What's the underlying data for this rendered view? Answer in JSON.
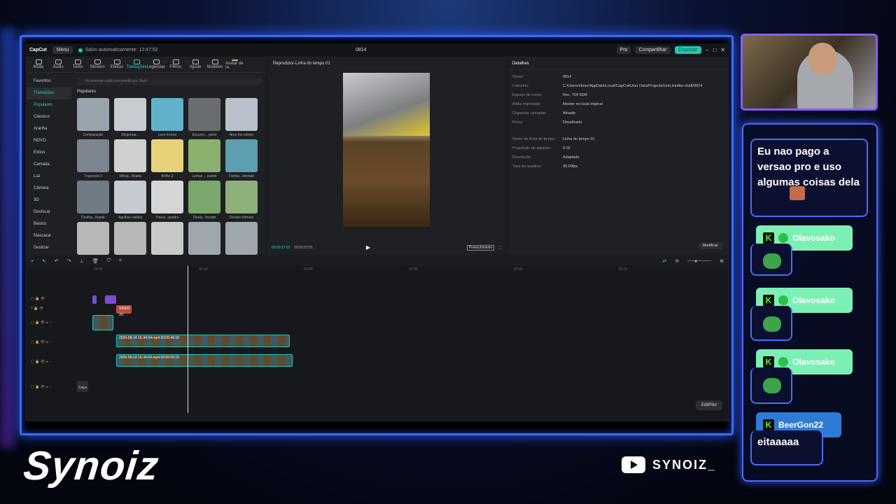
{
  "app": {
    "logo": "CapCut",
    "menu": "Menu",
    "autosave": "Salvo automaticamente: 12:47:52",
    "project_title": "0814",
    "pro": "Pro",
    "share": "Compartilhar",
    "export": "Exportar"
  },
  "tabs": [
    "Mídia",
    "Áudio",
    "Texto",
    "Stickers",
    "Efeitos",
    "Transições",
    "Legendas",
    "Filtros",
    "Ajuste",
    "Modelos",
    "Avatar de IA"
  ],
  "categories": [
    "Favoritos",
    "Transições",
    "Populares",
    "Clássico",
    "Aranha",
    "NOVO",
    "Exitos",
    "Camada",
    "Luz",
    "Câmera",
    "3D",
    "Desfocar",
    "Básico",
    "Mascarar",
    "Deslizar"
  ],
  "search_placeholder": "As pessoas estão procurando por: flash",
  "popular_label": "Populares",
  "transitions": [
    "Comparação",
    "Dispersar...",
    "Leve tremor",
    "Escurec... preto",
    "Arco-íris etéreo",
    "Travessia 3",
    "Vibraç...ficada",
    "Brilho 2",
    "Linhas ... painel",
    "Fantas...trêmulo",
    "Desfoq...lhante",
    "Agulhas radiais",
    "Transi...quadro",
    "Desliz...focado",
    "Deslize trêmulo",
    "",
    "",
    "",
    "",
    ""
  ],
  "player": {
    "title": "Reprodutor-Linha do tempo 01",
    "current": "00:00:27:03",
    "total": "00:00:57:01",
    "fill": "Preenchimento"
  },
  "details": {
    "title": "Detalhes",
    "rows": [
      {
        "k": "Nome:",
        "v": "0814"
      },
      {
        "k": "Caminho:",
        "v": "C:/Users/sbner/AppData/Local/CapCut/User Data/Projects/com.lveditor.draft/0814"
      },
      {
        "k": "Espaço de cores:",
        "v": "Rec. 709 SDR"
      },
      {
        "k": "Mídia importada:",
        "v": "Manter no local original"
      },
      {
        "k": "Organizar camadas",
        "v": "Ativado"
      },
      {
        "k": "Proxy:",
        "v": "Desativado"
      },
      {
        "k": "Nome da linha do tempo:",
        "v": "Linha do tempo 01"
      },
      {
        "k": "Proporção de aspecto:",
        "v": "9:16"
      },
      {
        "k": "Resolução:",
        "v": "Adaptado"
      },
      {
        "k": "Taxa de quadros:",
        "v": "30.00fps"
      }
    ],
    "modify": "Modificar"
  },
  "timeline": {
    "ruler": [
      "00:00",
      "00:30",
      "01:00",
      "01:30",
      "02:00",
      "02:30"
    ],
    "clip1": "2026-08-14 15-34-54.mp4  00:00:49:18",
    "clip2": "2026-08-14 15-34-54.mp4  00:00:50:15",
    "text_clip": "VIDEO JO",
    "cover": "Capa",
    "editpilot": "EditPilot"
  },
  "chat": {
    "message1": "Eu nao pago a versao pro e uso algumas coisas dela",
    "user1": "Olavosako",
    "user2": "Olavosako",
    "user3": "Olavosako",
    "user4": "BeerGon22",
    "message4": "eitaaaaa"
  },
  "brand": {
    "name": "Synoiz",
    "youtube": "SYNOIZ_"
  }
}
